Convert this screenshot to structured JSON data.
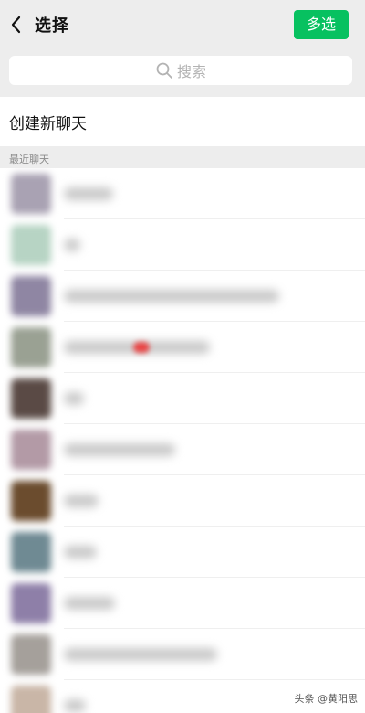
{
  "header": {
    "title": "选择",
    "multi_select_label": "多选"
  },
  "search": {
    "placeholder": "搜索"
  },
  "new_chat": {
    "label": "创建新聊天"
  },
  "recent": {
    "section_title": "最近聊天",
    "items": [
      {
        "avatar_color": "#a9a2b3"
      },
      {
        "avatar_color": "#b7d4c4"
      },
      {
        "avatar_color": "#8f86a3"
      },
      {
        "avatar_color": "#9aa193"
      },
      {
        "avatar_color": "#5a4a45"
      },
      {
        "avatar_color": "#b39aa6"
      },
      {
        "avatar_color": "#6b4c2e"
      },
      {
        "avatar_color": "#6f8a93"
      },
      {
        "avatar_color": "#8e7fa8"
      },
      {
        "avatar_color": "#a5a09b"
      },
      {
        "avatar_color": "#c9b6a7"
      }
    ]
  },
  "watermark": {
    "text": "头条 @黄阳思"
  },
  "colors": {
    "accent": "#07c160",
    "background": "#ededed",
    "placeholder": "#b3b3b3"
  },
  "icons": {
    "back": "chevron-left-icon",
    "search": "search-icon"
  }
}
